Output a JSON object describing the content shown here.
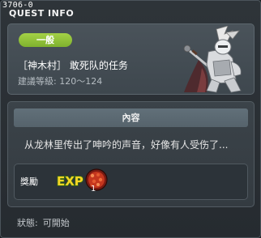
{
  "window": {
    "id": "3706-0",
    "title": "QUEST INFO"
  },
  "quest": {
    "category": "一般",
    "name": "［神木村］ 敢死队的任务",
    "level_range": "建議等級: 120～124",
    "npc_portrait": "armored-knight-npc"
  },
  "content": {
    "header": "內容",
    "text": "从龙林里传出了呻吟的声音，好像有人受伤了..."
  },
  "reward": {
    "label": "獎勵",
    "exp_icon": "EXP",
    "item_icon": "red-orb-item",
    "item_quantity": "1"
  },
  "status": {
    "label": "狀態:",
    "value": "可開始"
  },
  "colors": {
    "badge": "#8cc036",
    "exp_text": "#f6d526",
    "panel_bg": "#434c53"
  }
}
